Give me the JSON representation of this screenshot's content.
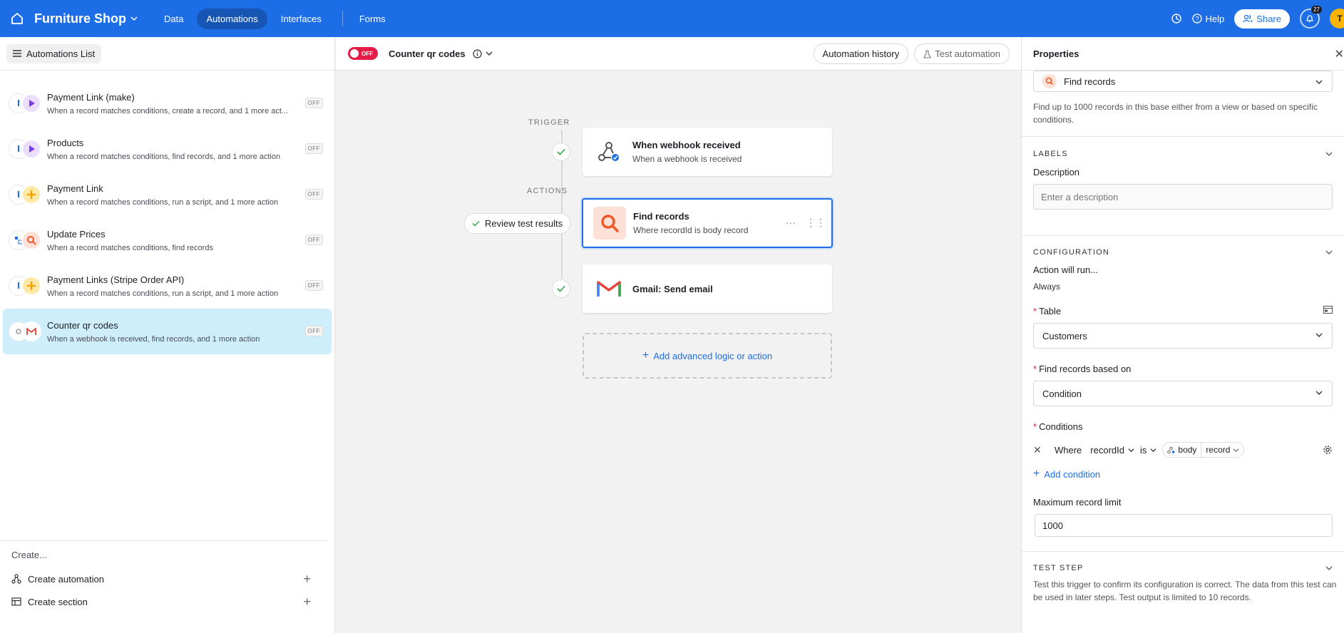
{
  "topbar": {
    "base_name": "Furniture Shop",
    "tabs": [
      "Data",
      "Automations",
      "Interfaces",
      "Forms"
    ],
    "help_label": "Help",
    "share_label": "Share",
    "notification_count": "27",
    "avatar_initial": "T"
  },
  "sidebar": {
    "header_label": "Automations List",
    "items": [
      {
        "name": "Payment Link (make)",
        "desc": "When a record matches conditions, create a record, and 1 more act...",
        "status": "OFF"
      },
      {
        "name": "Products",
        "desc": "When a record matches conditions, find records, and 1 more action",
        "status": "OFF"
      },
      {
        "name": "Payment Link",
        "desc": "When a record matches conditions, run a script, and 1 more action",
        "status": "OFF"
      },
      {
        "name": "Update Prices",
        "desc": "When a record matches conditions, find records",
        "status": "OFF"
      },
      {
        "name": "Payment Links (Stripe Order API)",
        "desc": "When a record matches conditions, run a script, and 1 more action",
        "status": "OFF"
      },
      {
        "name": "Counter qr codes",
        "desc": "When a webhook is received, find records, and 1 more action",
        "status": "OFF"
      }
    ],
    "create_label": "Create...",
    "create_automation": "Create automation",
    "create_section": "Create section"
  },
  "center": {
    "toggle_label": "OFF",
    "title": "Counter qr codes",
    "history_btn": "Automation history",
    "test_btn": "Test automation",
    "trigger_label": "TRIGGER",
    "actions_label": "ACTIONS",
    "trigger_step": {
      "title": "When webhook received",
      "sub": "When a webhook is received"
    },
    "find_step": {
      "title": "Find records",
      "sub": "Where recordId is body record"
    },
    "gmail_step": {
      "title": "Gmail: Send email"
    },
    "review_btn": "Review test results",
    "add_logic": "Add advanced logic or action"
  },
  "properties": {
    "title": "Properties",
    "action_type": "Find records",
    "action_hint": "Find up to 1000 records in this base either from a view or based on specific conditions.",
    "labels_title": "LABELS",
    "description_label": "Description",
    "description_placeholder": "Enter a description",
    "config_title": "CONFIGURATION",
    "run_label": "Action will run...",
    "run_value": "Always",
    "table_label": "Table",
    "table_value": "Customers",
    "based_on_label": "Find records based on",
    "based_on_value": "Condition",
    "conditions_label": "Conditions",
    "cond_where": "Where",
    "cond_field": "recordId",
    "cond_op": "is",
    "cond_token_a": "body",
    "cond_token_b": "record",
    "add_condition": "Add condition",
    "max_label": "Maximum record limit",
    "max_value": "1000",
    "test_title": "TEST STEP",
    "test_hint": "Test this trigger to confirm its configuration is correct. The data from this test can be used in later steps. Test output is limited to 10 records."
  },
  "colors": {
    "brand": "#1d6ee6",
    "off": "#e31d48",
    "selected": "#cfeefc"
  }
}
